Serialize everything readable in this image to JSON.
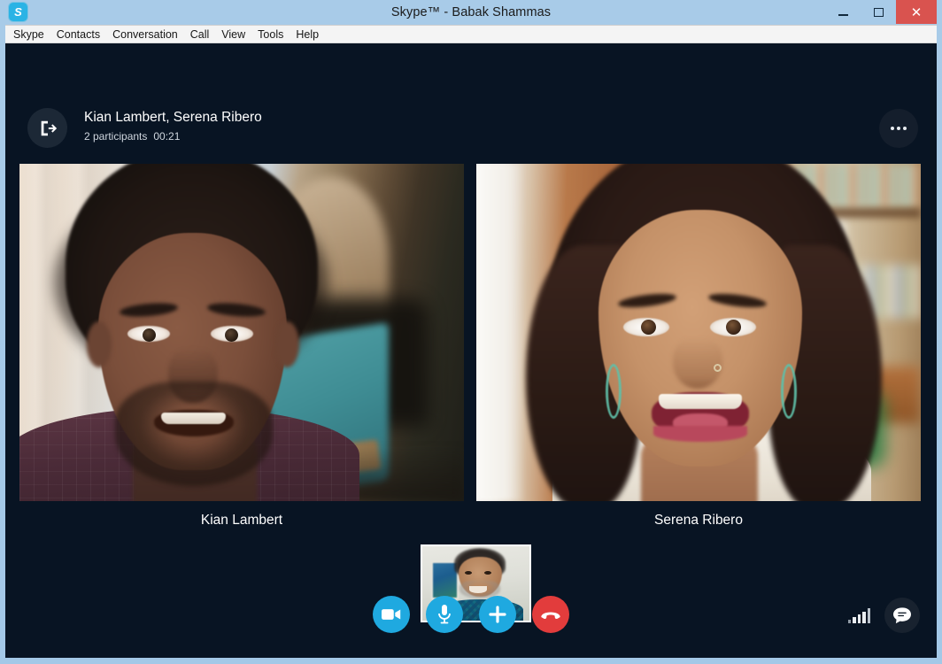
{
  "window": {
    "title": "Skype™ - Babak Shammas",
    "logo_icon": "skype-logo-icon",
    "logo_letter": "S",
    "controls": {
      "minimize": "minimize-icon",
      "maximize": "maximize-icon",
      "close_label": "✕"
    }
  },
  "menubar": {
    "items": [
      {
        "label": "Skype"
      },
      {
        "label": "Contacts"
      },
      {
        "label": "Conversation"
      },
      {
        "label": "Call"
      },
      {
        "label": "View"
      },
      {
        "label": "Tools"
      },
      {
        "label": "Help"
      }
    ]
  },
  "call": {
    "header": {
      "leave_icon": "leave-call-icon",
      "title": "Kian Lambert, Serena Ribero",
      "participants": "2 participants",
      "duration": "00:21",
      "more_icon": "more-options-icon"
    },
    "participants": [
      {
        "name": "Kian Lambert"
      },
      {
        "name": "Serena Ribero"
      }
    ],
    "self_view": {
      "label": "self-view"
    },
    "controls": [
      {
        "name": "video-toggle-button",
        "icon": "video-camera-icon",
        "color": "#1fa9e0"
      },
      {
        "name": "microphone-toggle-button",
        "icon": "microphone-icon",
        "color": "#1fa9e0"
      },
      {
        "name": "add-participant-button",
        "icon": "plus-icon",
        "color": "#1fa9e0"
      },
      {
        "name": "end-call-button",
        "icon": "hang-up-icon",
        "color": "#e23c3c"
      }
    ],
    "status": {
      "signal_icon": "signal-strength-icon",
      "chat_icon": "chat-bubble-icon"
    }
  },
  "colors": {
    "accent": "#1fa9e0",
    "danger": "#e23c3c",
    "call_background": "#081423",
    "window_frame": "#a3c8e7"
  }
}
